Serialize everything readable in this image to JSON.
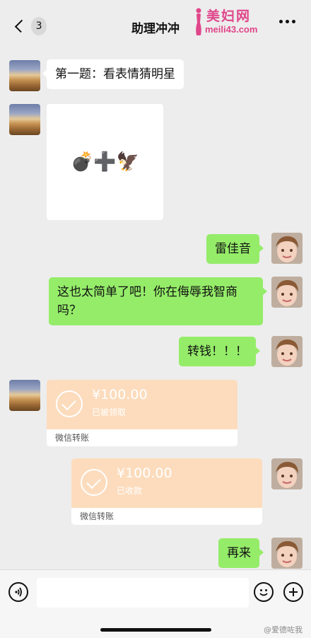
{
  "header": {
    "back_count": "3",
    "title": "助理冲冲",
    "watermark_cn": "美妇网",
    "watermark_url": "meili43.com"
  },
  "messages": [
    {
      "side": "left",
      "type": "text",
      "text": "第一题：看表情猜明星"
    },
    {
      "side": "left",
      "type": "image",
      "emoji": "💣➕🦅"
    },
    {
      "side": "right",
      "type": "text",
      "text": "雷佳音"
    },
    {
      "side": "right",
      "type": "text",
      "text": "这也太简单了吧！你在侮辱我智商吗？"
    },
    {
      "side": "right",
      "type": "text",
      "text": "转钱！！！"
    },
    {
      "side": "left",
      "type": "transfer",
      "amount": "¥100.00",
      "status": "已被领取",
      "footer": "微信转账"
    },
    {
      "side": "right",
      "type": "transfer",
      "amount": "¥100.00",
      "status": "已收款",
      "footer": "微信转账"
    },
    {
      "side": "right",
      "type": "text",
      "text": "再来"
    }
  ],
  "input_bar": {
    "voice_icon": "voice-icon",
    "emoji_icon": "emoji-icon",
    "plus_icon": "plus-icon",
    "credit": "@爱德咗我"
  },
  "colors": {
    "background": "#ededed",
    "green_bubble": "#95ec69",
    "white_bubble": "#ffffff",
    "transfer": "#fcdcbd",
    "watermark": "#e0468a"
  }
}
